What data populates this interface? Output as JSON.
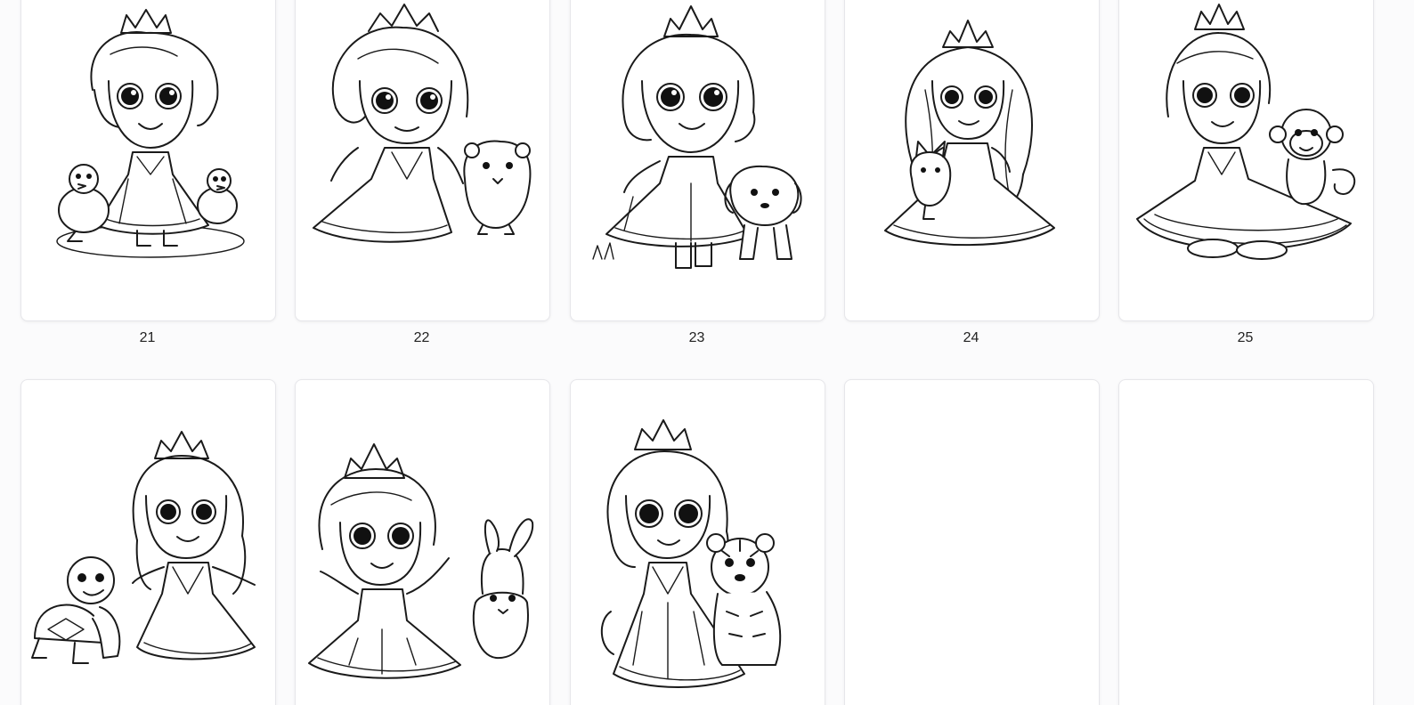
{
  "gallery": {
    "pages": [
      {
        "number": "21",
        "subject": "princess-with-ducklings"
      },
      {
        "number": "22",
        "subject": "princess-with-hamster"
      },
      {
        "number": "23",
        "subject": "princess-with-puppy"
      },
      {
        "number": "24",
        "subject": "princess-with-kitten"
      },
      {
        "number": "25",
        "subject": "princess-with-monkey"
      },
      {
        "subject": "princess-with-turtle"
      },
      {
        "subject": "princess-with-bunny"
      },
      {
        "subject": "princess-with-tiger"
      },
      {
        "subject": "empty-page"
      },
      {
        "subject": "empty-page"
      }
    ]
  }
}
